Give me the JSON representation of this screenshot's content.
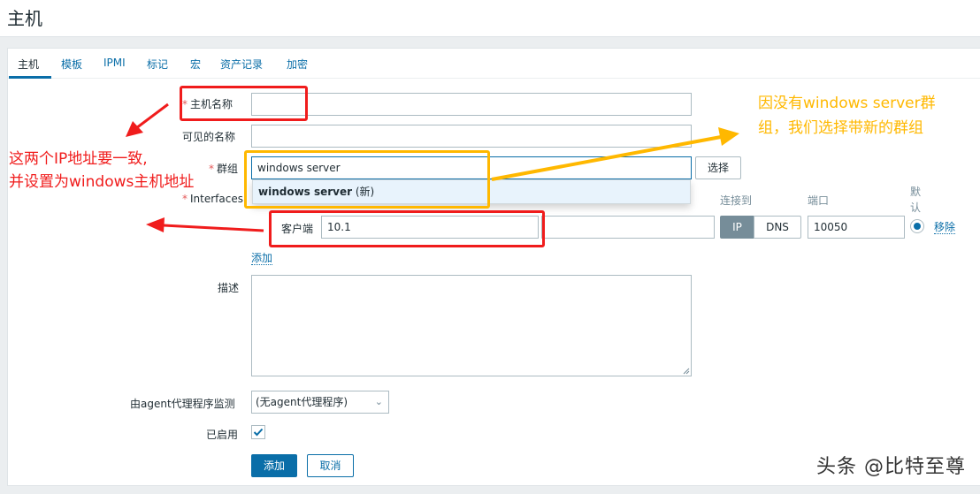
{
  "page": {
    "title": "主机"
  },
  "tabs": [
    {
      "label": "主机",
      "active": true
    },
    {
      "label": "模板"
    },
    {
      "label": "IPMI"
    },
    {
      "label": "标记"
    },
    {
      "label": "宏"
    },
    {
      "label": "资产记录"
    },
    {
      "label": "加密"
    }
  ],
  "form": {
    "host_name": {
      "label": "主机名称",
      "required_mark": "*",
      "value": ""
    },
    "visible_name": {
      "label": "可见的名称",
      "value": ""
    },
    "groups": {
      "label": "群组",
      "required_mark": "*",
      "value": "windows server",
      "select_label": "选择",
      "suggestion_bold": "windows server",
      "suggestion_suffix": " (新)"
    },
    "interfaces": {
      "label": "Interfaces",
      "required_mark": "*",
      "columns": {
        "connect_to": "连接到",
        "port": "端口",
        "default": "默认"
      },
      "rows": [
        {
          "type": "客户端",
          "ip": "10.1",
          "dns": "",
          "connect_ip": "IP",
          "connect_dns": "DNS",
          "connect_selected": "IP",
          "port": "10050",
          "default": true,
          "remove_label": "移除"
        }
      ],
      "add_label": "添加"
    },
    "description": {
      "label": "描述",
      "value": ""
    },
    "proxy": {
      "label": "由agent代理程序监测",
      "value": "(无agent代理程序)"
    },
    "enabled": {
      "label": "已启用",
      "checked": true
    },
    "submit_label": "添加",
    "cancel_label": "取消"
  },
  "annotations": {
    "red_text_line1": "这两个IP地址要一致,",
    "red_text_line2": "并设置为windows主机地址",
    "yellow_text": "因没有windows server群组，我们选择带新的群组",
    "red_color": "#f01c1c",
    "yellow_color": "#ffb800"
  },
  "watermark": "头条 @比特至尊",
  "colors": {
    "accent": "#0a6ea8",
    "required": "#e45959",
    "muted": "#768d99",
    "border": "#acbbc2"
  }
}
